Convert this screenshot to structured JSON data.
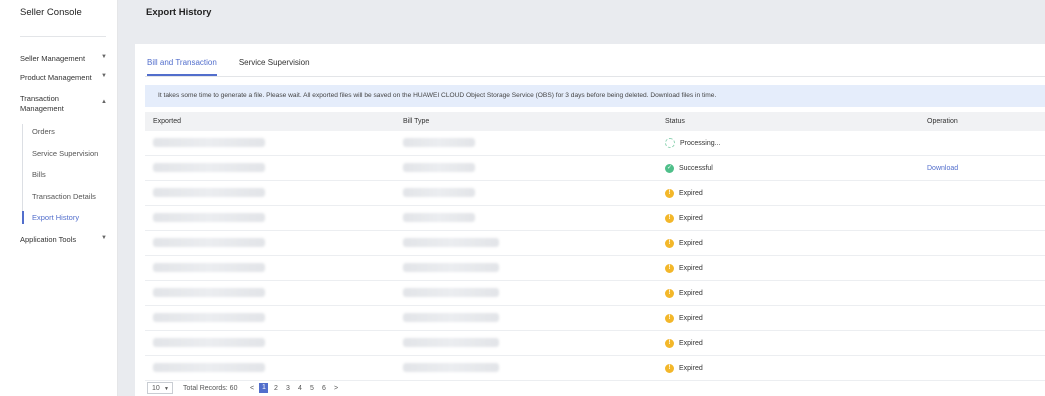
{
  "sidebar": {
    "title": "Seller Console",
    "items": [
      {
        "label": "Seller Management",
        "chev": "▼"
      },
      {
        "label": "Product Management",
        "chev": "▼"
      },
      {
        "label": "Transaction Management",
        "chev": "▲"
      },
      {
        "label": "Application Tools",
        "chev": "▼"
      }
    ],
    "subitems": [
      "Orders",
      "Service Supervision",
      "Bills",
      "Transaction Details",
      "Export History"
    ]
  },
  "page": {
    "title": "Export History"
  },
  "tabs": [
    "Bill and Transaction",
    "Service Supervision"
  ],
  "notice": "It takes some time to generate a file. Please wait. All exported files will be saved on the HUAWEI CLOUD Object Storage Service (OBS) for 3 days before being deleted. Download files in time.",
  "table": {
    "headers": [
      "Exported",
      "Bill Type",
      "Status",
      "Operation"
    ],
    "rows": [
      {
        "status": "Processing...",
        "status_type": "processing",
        "operation": ""
      },
      {
        "status": "Successful",
        "status_type": "success",
        "operation": "Download"
      },
      {
        "status": "Expired",
        "status_type": "expired",
        "operation": ""
      },
      {
        "status": "Expired",
        "status_type": "expired",
        "operation": ""
      },
      {
        "status": "Expired",
        "status_type": "expired",
        "operation": ""
      },
      {
        "status": "Expired",
        "status_type": "expired",
        "operation": ""
      },
      {
        "status": "Expired",
        "status_type": "expired",
        "operation": ""
      },
      {
        "status": "Expired",
        "status_type": "expired",
        "operation": ""
      },
      {
        "status": "Expired",
        "status_type": "expired",
        "operation": ""
      },
      {
        "status": "Expired",
        "status_type": "expired",
        "operation": ""
      }
    ]
  },
  "pagination": {
    "page_size": "10",
    "total": "Total Records: 60",
    "prev": "<",
    "next": ">",
    "pages": [
      "1",
      "2",
      "3",
      "4",
      "5",
      "6"
    ],
    "current": "1"
  },
  "colors": {
    "accent": "#526ecc",
    "success": "#4fbf8a",
    "warning": "#f3b72a",
    "notice_bg": "#e5edfb"
  }
}
